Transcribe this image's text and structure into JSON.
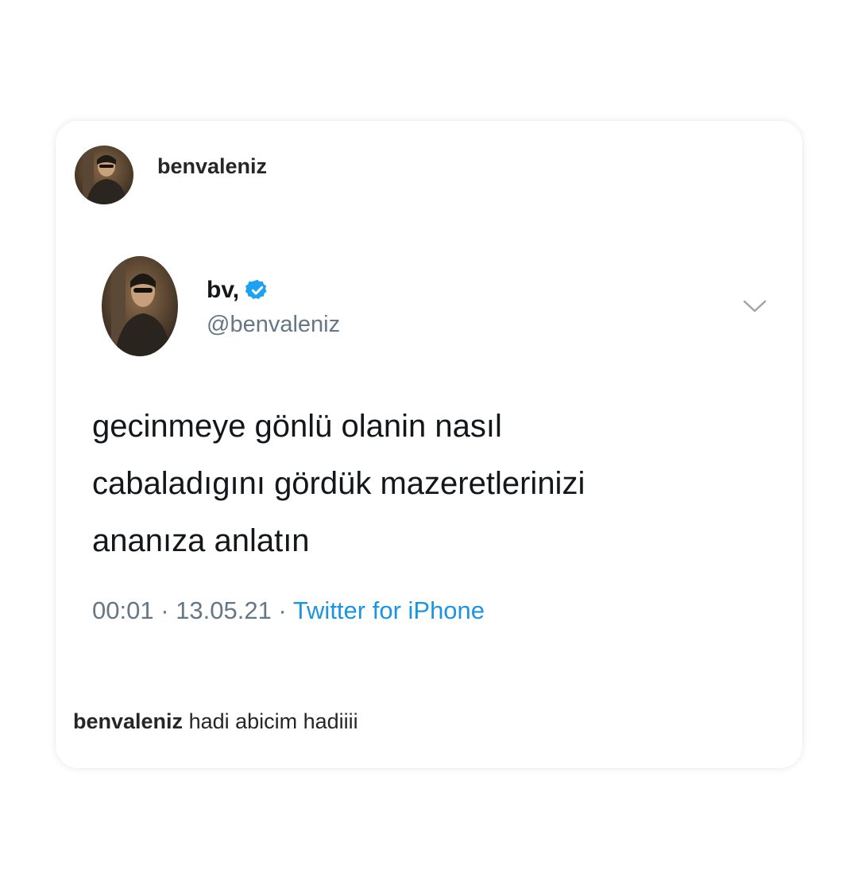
{
  "post": {
    "username": "benvaleniz"
  },
  "tweet": {
    "display_name": "bv,",
    "handle": "@benvaleniz",
    "text_lines": [
      "gecinmeye gönlü olanin nasıl",
      "cabaladıgını gördük mazeretlerinizi",
      "ananıza anlatın"
    ],
    "time": "00:01",
    "date": "13.05.21",
    "separator": " · ",
    "source": "Twitter for iPhone",
    "verified_color": "#1da1f2"
  },
  "caption": {
    "username": "benvaleniz",
    "text": "hadi abicim hadiiii"
  },
  "icons": {
    "verified": "verified-badge-icon",
    "chevron": "chevron-down-icon"
  }
}
